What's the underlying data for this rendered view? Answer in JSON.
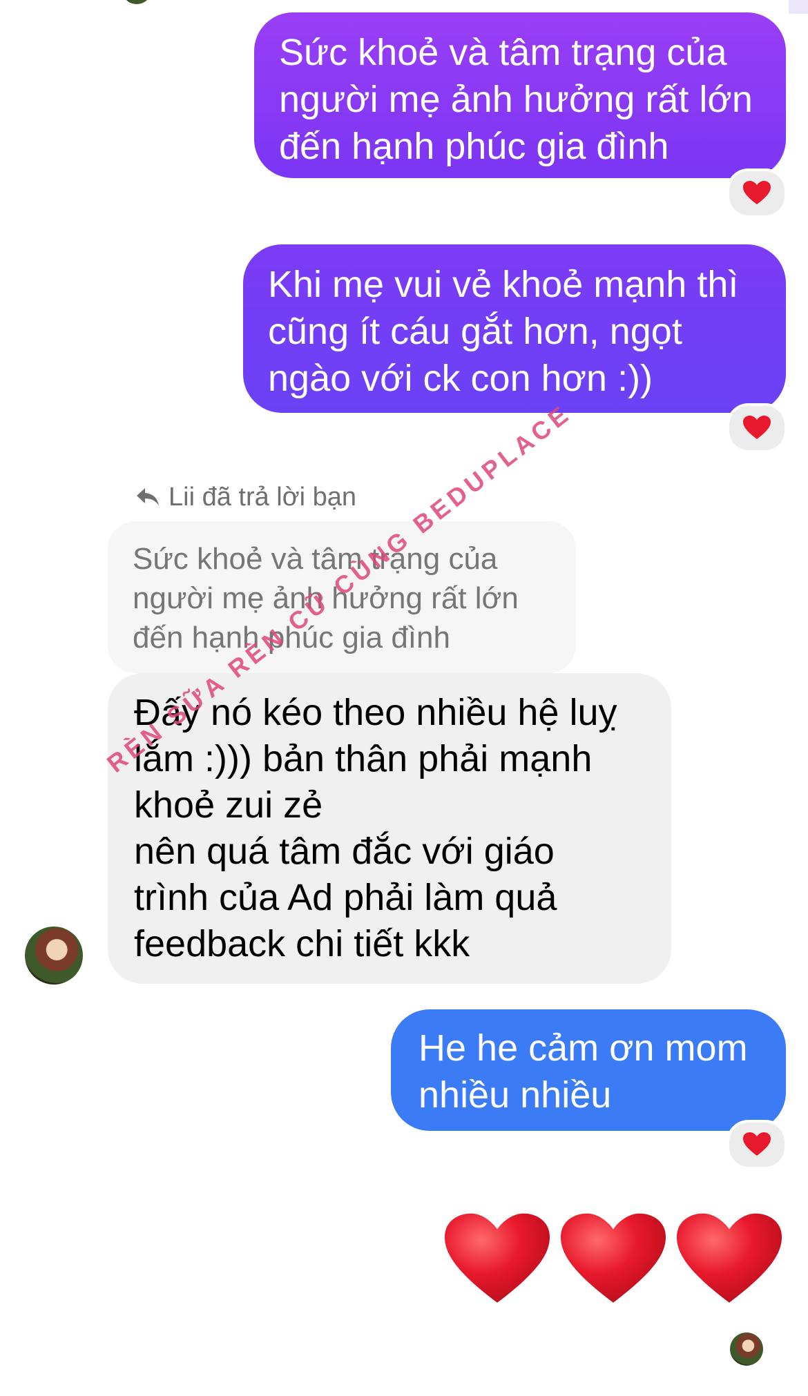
{
  "messages": {
    "out1": "Sức khoẻ và tâm trạng của\nngười mẹ ảnh hưởng rất lớn\nđến hạnh phúc gia đình",
    "out2": "Khi mẹ vui vẻ khoẻ mạnh thì\ncũng ít cáu gắt hơn, ngọt\nngào với ck con hơn :))",
    "reply_label": "Lii đã trả lời bạn",
    "quoted": "Sức khoẻ và tâm trạng của\nngười mẹ ảnh hưởng rất lớn\nđến hạnh phúc gia đình",
    "incoming": "Đấy nó kéo theo nhiều hệ luỵ\nlắm :))) bản thân phải mạnh\nkhoẻ zui zẻ\nnên quá tâm đắc với giáo\ntrình của Ad phải làm quả\nfeedback chi tiết kkk",
    "out3": "He he cảm ơn mom\nnhiều nhiều"
  },
  "watermark": "RÈN SỮA RÈN CỮ CÙNG BEDUPLACE",
  "reactions": [
    "heart",
    "heart",
    "heart"
  ],
  "big_emoji_count": 3,
  "colors": {
    "out_purple": "#9a3ef5",
    "out_blue": "#3b7cf6",
    "incoming": "#f0f0f0",
    "heart": "#e8192c",
    "watermark": "#e0457b"
  }
}
